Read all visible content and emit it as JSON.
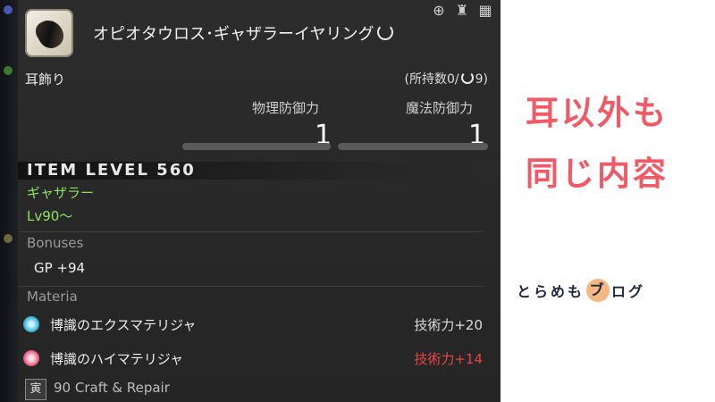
{
  "tooltip": {
    "item_name": "オピオタウロス･ギャザラーイヤリング",
    "slot": "耳飾り",
    "owned": "(所持数0/",
    "owned_suffix": "9)",
    "stats": [
      {
        "label": "物理防御力",
        "value": "1"
      },
      {
        "label": "魔法防御力",
        "value": "1"
      }
    ],
    "item_level": "ITEM LEVEL 560",
    "job": "ギャザラー",
    "level_req": "Lv90～",
    "bonuses_title": "Bonuses",
    "bonuses": [
      "GP +94"
    ],
    "materia_title": "Materia",
    "materia": [
      {
        "name": "博識のエクスマテリジャ",
        "value": "技術力+20",
        "color": "#dcdcdc"
      },
      {
        "name": "博識のハイマテリジャ",
        "value": "技術力+14",
        "color": "#e84545"
      }
    ],
    "craft_level": "90",
    "craft_text": "Craft & Repair",
    "craft_icon_glyph": "寅"
  },
  "caption": {
    "line1": "耳以外も",
    "line2": "同じ内容"
  },
  "logo": {
    "before": "とらめも",
    "circle": "ブ",
    "after": "ログ"
  },
  "colors": {
    "accent_green": "#8ee35e",
    "caption_pink": "#f05a66",
    "logo_orange": "#f4b882",
    "alert_red": "#e84545"
  }
}
